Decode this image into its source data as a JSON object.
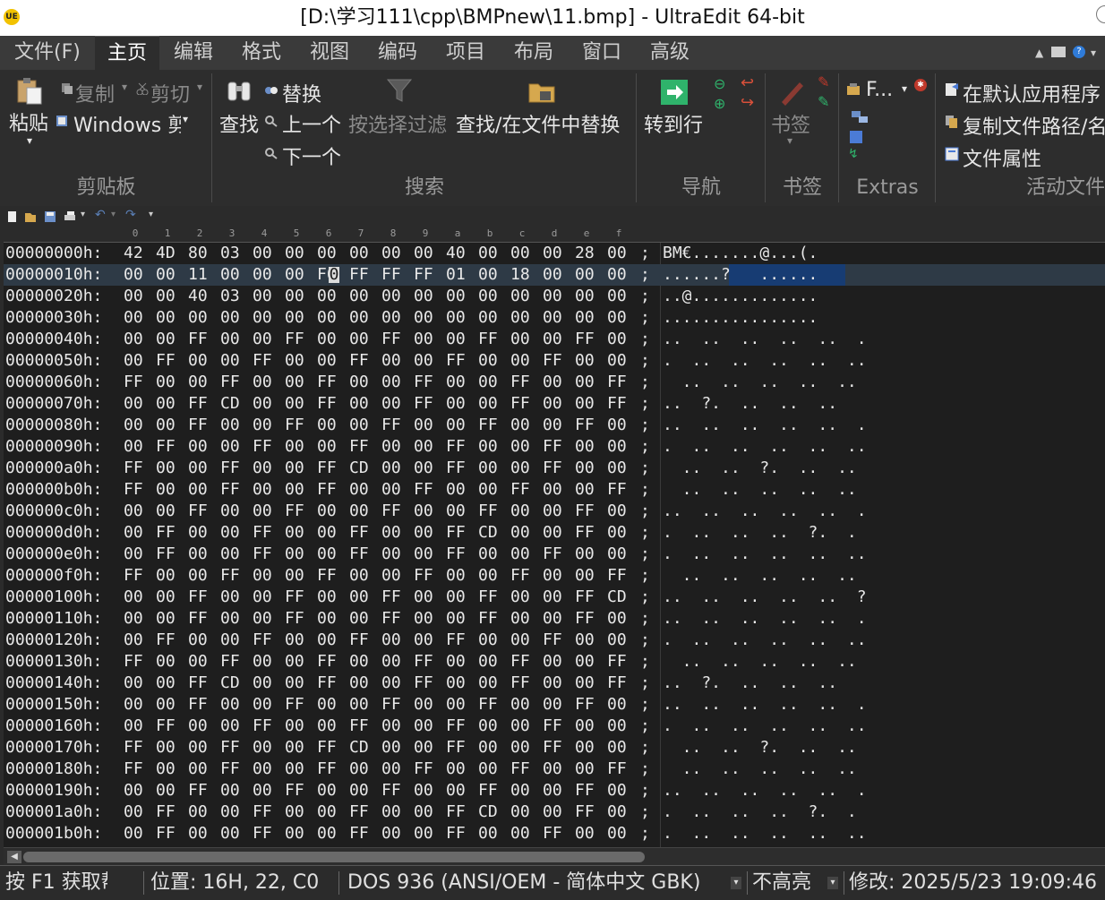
{
  "window": {
    "title": "[D:\\学习111\\cpp\\BMPnew\\11.bmp] - UltraEdit 64-bit",
    "app_logo_text": "UE"
  },
  "menu": {
    "tabs": [
      "文件(F)",
      "主页",
      "编辑",
      "格式",
      "视图",
      "编码",
      "项目",
      "布局",
      "窗口",
      "高级"
    ],
    "active": "主页"
  },
  "ribbon": {
    "clipboard": {
      "label": "剪贴板",
      "paste": "粘贴",
      "copy": "复制",
      "cut": "剪切",
      "line_ending": "Windows 剪"
    },
    "search": {
      "label": "搜索",
      "find": "查找",
      "replace": "替换",
      "prev": "上一个",
      "next": "下一个",
      "filter": "按选择过滤",
      "find_in_files": "查找/在文件中替换"
    },
    "navigate": {
      "label": "导航",
      "goto": "转到行"
    },
    "bookmarks": {
      "label": "书签",
      "bookmark": "书签"
    },
    "extras": {
      "label": "Extras",
      "f_button": "F..."
    },
    "active_file": {
      "label": "活动文件",
      "open_default": "在默认应用程序",
      "copy_path": "复制文件路径/名",
      "file_props": "文件属性"
    }
  },
  "ruler": {
    "columns": [
      "0",
      "1",
      "2",
      "3",
      "4",
      "5",
      "6",
      "7",
      "8",
      "9",
      "a",
      "b",
      "c",
      "d",
      "e",
      "f"
    ]
  },
  "hex": {
    "active_row": 1,
    "rows": [
      {
        "addr": "00000000h:",
        "bytes": "42 4D 80 03 00 00 00 00 00 00 40 00 00 00 28 00",
        "ascii": "BM€.......@...(."
      },
      {
        "addr": "00000010h:",
        "bytes": "00 00 11 00 00 00 F0 FF FF FF 01 00 18 00 00 00",
        "ascii": "......?   ......"
      },
      {
        "addr": "00000020h:",
        "bytes": "00 00 40 03 00 00 00 00 00 00 00 00 00 00 00 00",
        "ascii": "..@............."
      },
      {
        "addr": "00000030h:",
        "bytes": "00 00 00 00 00 00 00 00 00 00 00 00 00 00 00 00",
        "ascii": "................"
      },
      {
        "addr": "00000040h:",
        "bytes": "00 00 FF 00 00 FF 00 00 FF 00 00 FF 00 00 FF 00",
        "ascii": "..  ..  ..  ..  ..  ."
      },
      {
        "addr": "00000050h:",
        "bytes": "00 FF 00 00 FF 00 00 FF 00 00 FF 00 00 FF 00 00",
        "ascii": ".  ..  ..  ..  ..  .."
      },
      {
        "addr": "00000060h:",
        "bytes": "FF 00 00 FF 00 00 FF 00 00 FF 00 00 FF 00 00 FF",
        "ascii": "  ..  ..  ..  ..  .."
      },
      {
        "addr": "00000070h:",
        "bytes": "00 00 FF CD 00 00 FF 00 00 FF 00 00 FF 00 00 FF",
        "ascii": "..  ?.  ..  ..  .."
      },
      {
        "addr": "00000080h:",
        "bytes": "00 00 FF 00 00 FF 00 00 FF 00 00 FF 00 00 FF 00",
        "ascii": "..  ..  ..  ..  ..  ."
      },
      {
        "addr": "00000090h:",
        "bytes": "00 FF 00 00 FF 00 00 FF 00 00 FF 00 00 FF 00 00",
        "ascii": ".  ..  ..  ..  ..  .."
      },
      {
        "addr": "000000a0h:",
        "bytes": "FF 00 00 FF 00 00 FF CD 00 00 FF 00 00 FF 00 00",
        "ascii": "  ..  ..  ?.  ..  .."
      },
      {
        "addr": "000000b0h:",
        "bytes": "FF 00 00 FF 00 00 FF 00 00 FF 00 00 FF 00 00 FF",
        "ascii": "  ..  ..  ..  ..  .."
      },
      {
        "addr": "000000c0h:",
        "bytes": "00 00 FF 00 00 FF 00 00 FF 00 00 FF 00 00 FF 00",
        "ascii": "..  ..  ..  ..  ..  ."
      },
      {
        "addr": "000000d0h:",
        "bytes": "00 FF 00 00 FF 00 00 FF 00 00 FF CD 00 00 FF 00",
        "ascii": ".  ..  ..  ..  ?.  ."
      },
      {
        "addr": "000000e0h:",
        "bytes": "00 FF 00 00 FF 00 00 FF 00 00 FF 00 00 FF 00 00",
        "ascii": ".  ..  ..  ..  ..  .."
      },
      {
        "addr": "000000f0h:",
        "bytes": "FF 00 00 FF 00 00 FF 00 00 FF 00 00 FF 00 00 FF",
        "ascii": "  ..  ..  ..  ..  .."
      },
      {
        "addr": "00000100h:",
        "bytes": "00 00 FF 00 00 FF 00 00 FF 00 00 FF 00 00 FF CD",
        "ascii": "..  ..  ..  ..  ..  ?"
      },
      {
        "addr": "00000110h:",
        "bytes": "00 00 FF 00 00 FF 00 00 FF 00 00 FF 00 00 FF 00",
        "ascii": "..  ..  ..  ..  ..  ."
      },
      {
        "addr": "00000120h:",
        "bytes": "00 FF 00 00 FF 00 00 FF 00 00 FF 00 00 FF 00 00",
        "ascii": ".  ..  ..  ..  ..  .."
      },
      {
        "addr": "00000130h:",
        "bytes": "FF 00 00 FF 00 00 FF 00 00 FF 00 00 FF 00 00 FF",
        "ascii": "  ..  ..  ..  ..  .."
      },
      {
        "addr": "00000140h:",
        "bytes": "00 00 FF CD 00 00 FF 00 00 FF 00 00 FF 00 00 FF",
        "ascii": "..  ?.  ..  ..  .."
      },
      {
        "addr": "00000150h:",
        "bytes": "00 00 FF 00 00 FF 00 00 FF 00 00 FF 00 00 FF 00",
        "ascii": "..  ..  ..  ..  ..  ."
      },
      {
        "addr": "00000160h:",
        "bytes": "00 FF 00 00 FF 00 00 FF 00 00 FF 00 00 FF 00 00",
        "ascii": ".  ..  ..  ..  ..  .."
      },
      {
        "addr": "00000170h:",
        "bytes": "FF 00 00 FF 00 00 FF CD 00 00 FF 00 00 FF 00 00",
        "ascii": "  ..  ..  ?.  ..  .."
      },
      {
        "addr": "00000180h:",
        "bytes": "FF 00 00 FF 00 00 FF 00 00 FF 00 00 FF 00 00 FF",
        "ascii": "  ..  ..  ..  ..  .."
      },
      {
        "addr": "00000190h:",
        "bytes": "00 00 FF 00 00 FF 00 00 FF 00 00 FF 00 00 FF 00",
        "ascii": "..  ..  ..  ..  ..  ."
      },
      {
        "addr": "000001a0h:",
        "bytes": "00 FF 00 00 FF 00 00 FF 00 00 FF CD 00 00 FF 00",
        "ascii": ".  ..  ..  ..  ?.  ."
      },
      {
        "addr": "000001b0h:",
        "bytes": "00 FF 00 00 FF 00 00 FF 00 00 FF 00 00 FF 00 00",
        "ascii": ".  ..  ..  ..  ..  .."
      }
    ]
  },
  "status": {
    "help": "按 F1 获取帮",
    "position": "位置: 16H, 22, C0",
    "encoding": "DOS 936   (ANSI/OEM - 简体中文 GBK)",
    "highlight": "不高亮",
    "modified": "修改:   2025/5/23 19:09:46"
  },
  "colors": {
    "accent": "#173c73",
    "goto_icon": "#2fb36b",
    "bookmark_icon": "#c0392b"
  }
}
